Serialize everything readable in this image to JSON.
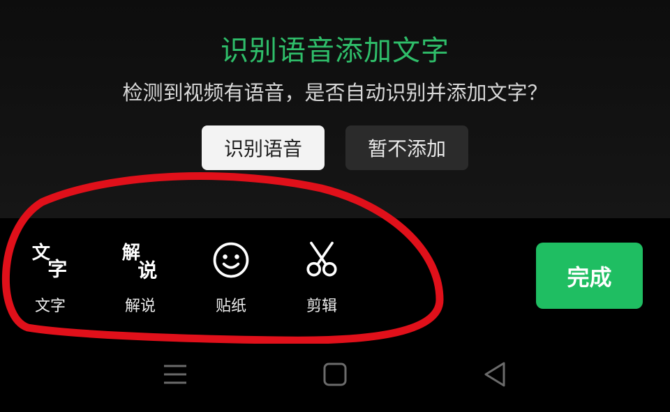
{
  "prompt": {
    "title": "识别语音添加文字",
    "subtitle": "检测到视频有语音，是否自动识别并添加文字？",
    "recognize_label": "识别语音",
    "skip_label": "暂不添加"
  },
  "toolbar": {
    "items": [
      {
        "label": "文字",
        "icon": "text-icon"
      },
      {
        "label": "解说",
        "icon": "narration-icon"
      },
      {
        "label": "贴纸",
        "icon": "smiley-icon"
      },
      {
        "label": "剪辑",
        "icon": "scissors-icon"
      }
    ],
    "done_label": "完成"
  },
  "nav": {
    "icons": [
      "menu-icon",
      "home-icon",
      "back-icon"
    ]
  },
  "colors": {
    "accent_green": "#2fbe6a",
    "done_green": "#1fbe62",
    "annotation_red": "#e0101a",
    "background": "#000000"
  }
}
